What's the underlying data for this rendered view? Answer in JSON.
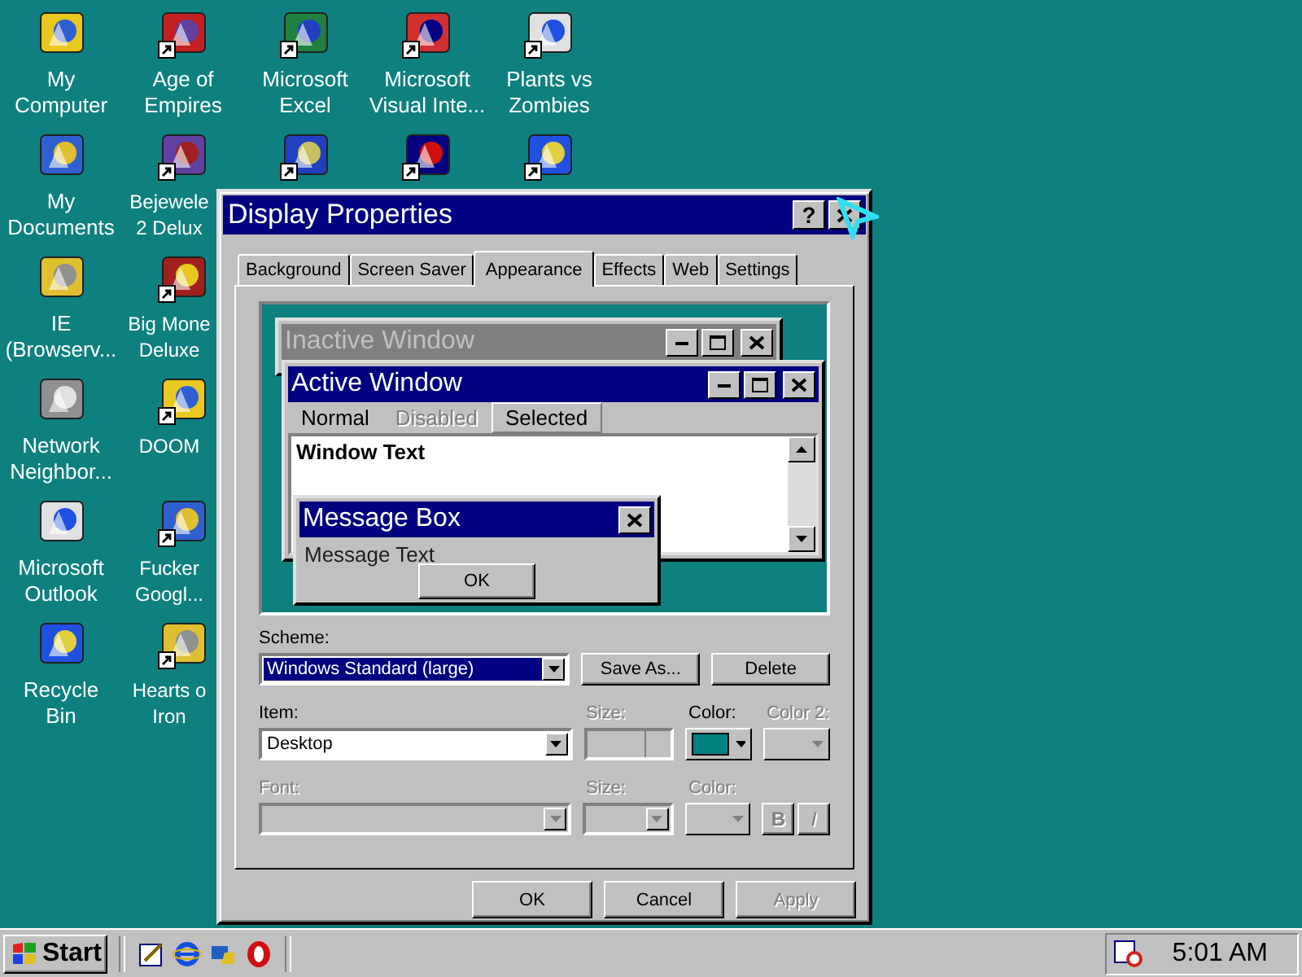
{
  "desktop": {
    "rows": [
      [
        {
          "label": "My\nComputer",
          "shortcut": false
        },
        {
          "label": "Age of\nEmpires",
          "shortcut": true
        },
        {
          "label": "Microsoft\nExcel",
          "shortcut": true
        },
        {
          "label": "Microsoft\nVisual Inte...",
          "shortcut": true
        },
        {
          "label": "Plants vs\nZombies",
          "shortcut": true
        }
      ],
      [
        {
          "label": "My\nDocuments",
          "shortcut": false
        },
        {
          "label": "Bejewele\n2 Delux",
          "shortcut": true
        },
        {
          "shortcut": true
        },
        {
          "shortcut": true
        },
        {
          "shortcut": true
        }
      ],
      [
        {
          "label": "IE\n(Browserv...",
          "shortcut": false
        },
        {
          "label": "Big Mone\nDeluxe",
          "shortcut": true
        }
      ],
      [
        {
          "label": "Network\nNeighbor...",
          "shortcut": false
        },
        {
          "label": "DOOM",
          "shortcut": true
        }
      ],
      [
        {
          "label": "Microsoft\nOutlook",
          "shortcut": false
        },
        {
          "label": "Fucker\nGoogl...",
          "shortcut": true
        }
      ],
      [
        {
          "label": "Recycle\nBin",
          "shortcut": false
        },
        {
          "label": "Hearts o\nIron",
          "shortcut": true
        }
      ]
    ]
  },
  "window": {
    "title": "Display Properties",
    "help_button": "?",
    "tabs": [
      {
        "label": "Background",
        "selected": false
      },
      {
        "label": "Screen Saver",
        "selected": false
      },
      {
        "label": "Appearance",
        "selected": true
      },
      {
        "label": "Effects",
        "selected": false
      },
      {
        "label": "Web",
        "selected": false
      },
      {
        "label": "Settings",
        "selected": false
      }
    ],
    "preview": {
      "inactive_title": "Inactive Window",
      "active_title": "Active Window",
      "menu": [
        {
          "label": "Normal",
          "kind": "normal"
        },
        {
          "label": "Disabled",
          "kind": "disabled"
        },
        {
          "label": "Selected",
          "kind": "selected"
        }
      ],
      "window_text": "Window Text",
      "message_title": "Message Box",
      "message_text": "Message Text",
      "ok_button": "OK"
    },
    "scheme": {
      "label": "Scheme:",
      "value": "Windows Standard (large)",
      "save_button": "Save As...",
      "delete_button": "Delete"
    },
    "item": {
      "label": "Item:",
      "value": "Desktop",
      "size_label": "Size:",
      "size_disabled": true,
      "color_label": "Color:",
      "color": "#008080",
      "color_disabled": false,
      "color2_label": "Color 2:",
      "color2_disabled": true
    },
    "font": {
      "label": "Font:",
      "disabled": true,
      "size_label": "Size:",
      "color_label": "Color:",
      "bold_button": "B",
      "italic_button": "I"
    },
    "buttons": [
      {
        "label": "OK",
        "disabled": false
      },
      {
        "label": "Cancel",
        "disabled": false
      },
      {
        "label": "Apply",
        "disabled": true
      }
    ]
  },
  "taskbar": {
    "start": "Start",
    "clock": "5:01 AM"
  }
}
